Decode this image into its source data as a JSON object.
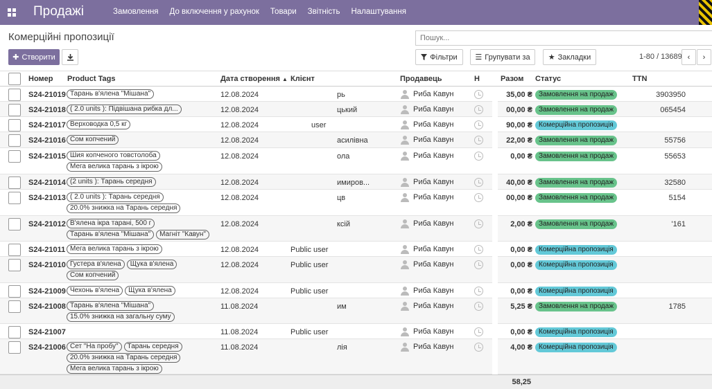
{
  "nav": {
    "brand": "Продажі",
    "menu": [
      "Замовлення",
      "До включення у рахунок",
      "Товари",
      "Звітність",
      "Налаштування"
    ]
  },
  "page": {
    "title": "Комерційні пропозиції",
    "search_placeholder": "Пошук...",
    "create_label": "Створити",
    "filters_label": "Фільтри",
    "group_label": "Групувати за",
    "favorites_label": "Закладки",
    "pager": "1-80 / 13689"
  },
  "columns": {
    "number": "Номер",
    "tags": "Product Tags",
    "date": "Дата створення",
    "client": "Клієнт",
    "seller": "Продавець",
    "activity": "Н",
    "total": "Разом",
    "status": "Статус",
    "ttn": "TTN"
  },
  "rows": [
    {
      "number": "S24-21019",
      "tags": [
        "Тарань в'ялена \"Мішана\""
      ],
      "date": "12.08.2024",
      "client": "рь",
      "seller": "Риба Кавун",
      "total": "35,00 ₴",
      "status": "Замовлення на продаж",
      "status_type": "order",
      "ttn": "3903950"
    },
    {
      "number": "S24-21018",
      "tags": [
        "( 2.0 units ): Підвішана рибка дл..."
      ],
      "date": "12.08.2024",
      "client": "цький",
      "seller": "Риба Кавун",
      "total": "00,00 ₴",
      "status": "Замовлення на продаж",
      "status_type": "order",
      "ttn": "065454"
    },
    {
      "number": "S24-21017",
      "tags": [
        "Верховодка 0,5 кг"
      ],
      "date": "12.08.2024",
      "client": "user",
      "seller": "Риба Кавун",
      "total": "90,00 ₴",
      "status": "Комерційна пропозиція",
      "status_type": "quote",
      "ttn": ""
    },
    {
      "number": "S24-21016",
      "tags": [
        "Сом копчений"
      ],
      "date": "12.08.2024",
      "client": "асилівна",
      "seller": "Риба Кавун",
      "total": "22,00 ₴",
      "status": "Замовлення на продаж",
      "status_type": "order",
      "ttn": "55756"
    },
    {
      "number": "S24-21015",
      "tags": [
        "Шия копченого товстолоба",
        "Мега велика тарань з ікрою"
      ],
      "date": "12.08.2024",
      "client": "ола",
      "seller": "Риба Кавун",
      "total": "0,00 ₴",
      "status": "Замовлення на продаж",
      "status_type": "order",
      "ttn": "55653"
    },
    {
      "number": "S24-21014",
      "tags": [
        "(2 units ): Тарань середня"
      ],
      "date": "12.08.2024",
      "client": "имиров...",
      "seller": "Риба Кавун",
      "total": "40,00 ₴",
      "status": "Замовлення на продаж",
      "status_type": "order",
      "ttn": "32580"
    },
    {
      "number": "S24-21013",
      "tags": [
        "( 2.0 units ): Тарань середня",
        "20.0% знижка на Тарань середня"
      ],
      "date": "12.08.2024",
      "client": "цв",
      "seller": "Риба Кавун",
      "total": "00,00 ₴",
      "status": "Замовлення на продаж",
      "status_type": "order",
      "ttn": "5154"
    },
    {
      "number": "S24-21012",
      "tags": [
        "В'ялена ікра тарані, 500 г",
        "Тарань в'ялена \"Мішана\"",
        "Магніт \"Кавун\""
      ],
      "date": "12.08.2024",
      "client": "ксій",
      "seller": "Риба Кавун",
      "total": "2,00 ₴",
      "status": "Замовлення на продаж",
      "status_type": "order",
      "ttn": "'161"
    },
    {
      "number": "S24-21011",
      "tags": [
        "Мега велика тарань з ікрою"
      ],
      "date": "12.08.2024",
      "client": "Public user",
      "seller": "Риба Кавун",
      "total": "0,00 ₴",
      "status": "Комерційна пропозиція",
      "status_type": "quote",
      "ttn": ""
    },
    {
      "number": "S24-21010",
      "tags": [
        "Густера в'ялена",
        "Щука в'ялена",
        "Сом копчений"
      ],
      "date": "12.08.2024",
      "client": "Public user",
      "seller": "Риба Кавун",
      "total": "0,00 ₴",
      "status": "Комерційна пропозиція",
      "status_type": "quote",
      "ttn": ""
    },
    {
      "number": "S24-21009",
      "tags": [
        "Чехонь в'ялена",
        "Щука в'ялена"
      ],
      "date": "12.08.2024",
      "client": "Public user",
      "seller": "Риба Кавун",
      "total": "0,00 ₴",
      "status": "Комерційна пропозиція",
      "status_type": "quote",
      "ttn": ""
    },
    {
      "number": "S24-21008",
      "tags": [
        "Тарань в'ялена \"Мішана\"",
        "15.0% знижка на загальну суму"
      ],
      "date": "11.08.2024",
      "client": "им",
      "seller": "Риба Кавун",
      "total": "5,25 ₴",
      "status": "Замовлення на продаж",
      "status_type": "order",
      "ttn": "1785"
    },
    {
      "number": "S24-21007",
      "tags": [],
      "date": "11.08.2024",
      "client": "Public user",
      "seller": "Риба Кавун",
      "total": "0,00 ₴",
      "status": "Комерційна пропозиція",
      "status_type": "quote",
      "ttn": ""
    },
    {
      "number": "S24-21006",
      "tags": [
        "Сет \"На пробу\"",
        "Тарань середня",
        "20.0% знижка на Тарань середня",
        "Мега велика тарань з ікрою"
      ],
      "date": "11.08.2024",
      "client": "лія",
      "seller": "Риба Кавун",
      "total": "4,00 ₴",
      "status": "Комерційна пропозиція",
      "status_type": "quote",
      "ttn": ""
    }
  ],
  "footer": {
    "total": "58,25"
  },
  "colors": {
    "brand": "#7c6f9e",
    "order_badge": "#68c38b",
    "quote_badge": "#63c9d8"
  }
}
